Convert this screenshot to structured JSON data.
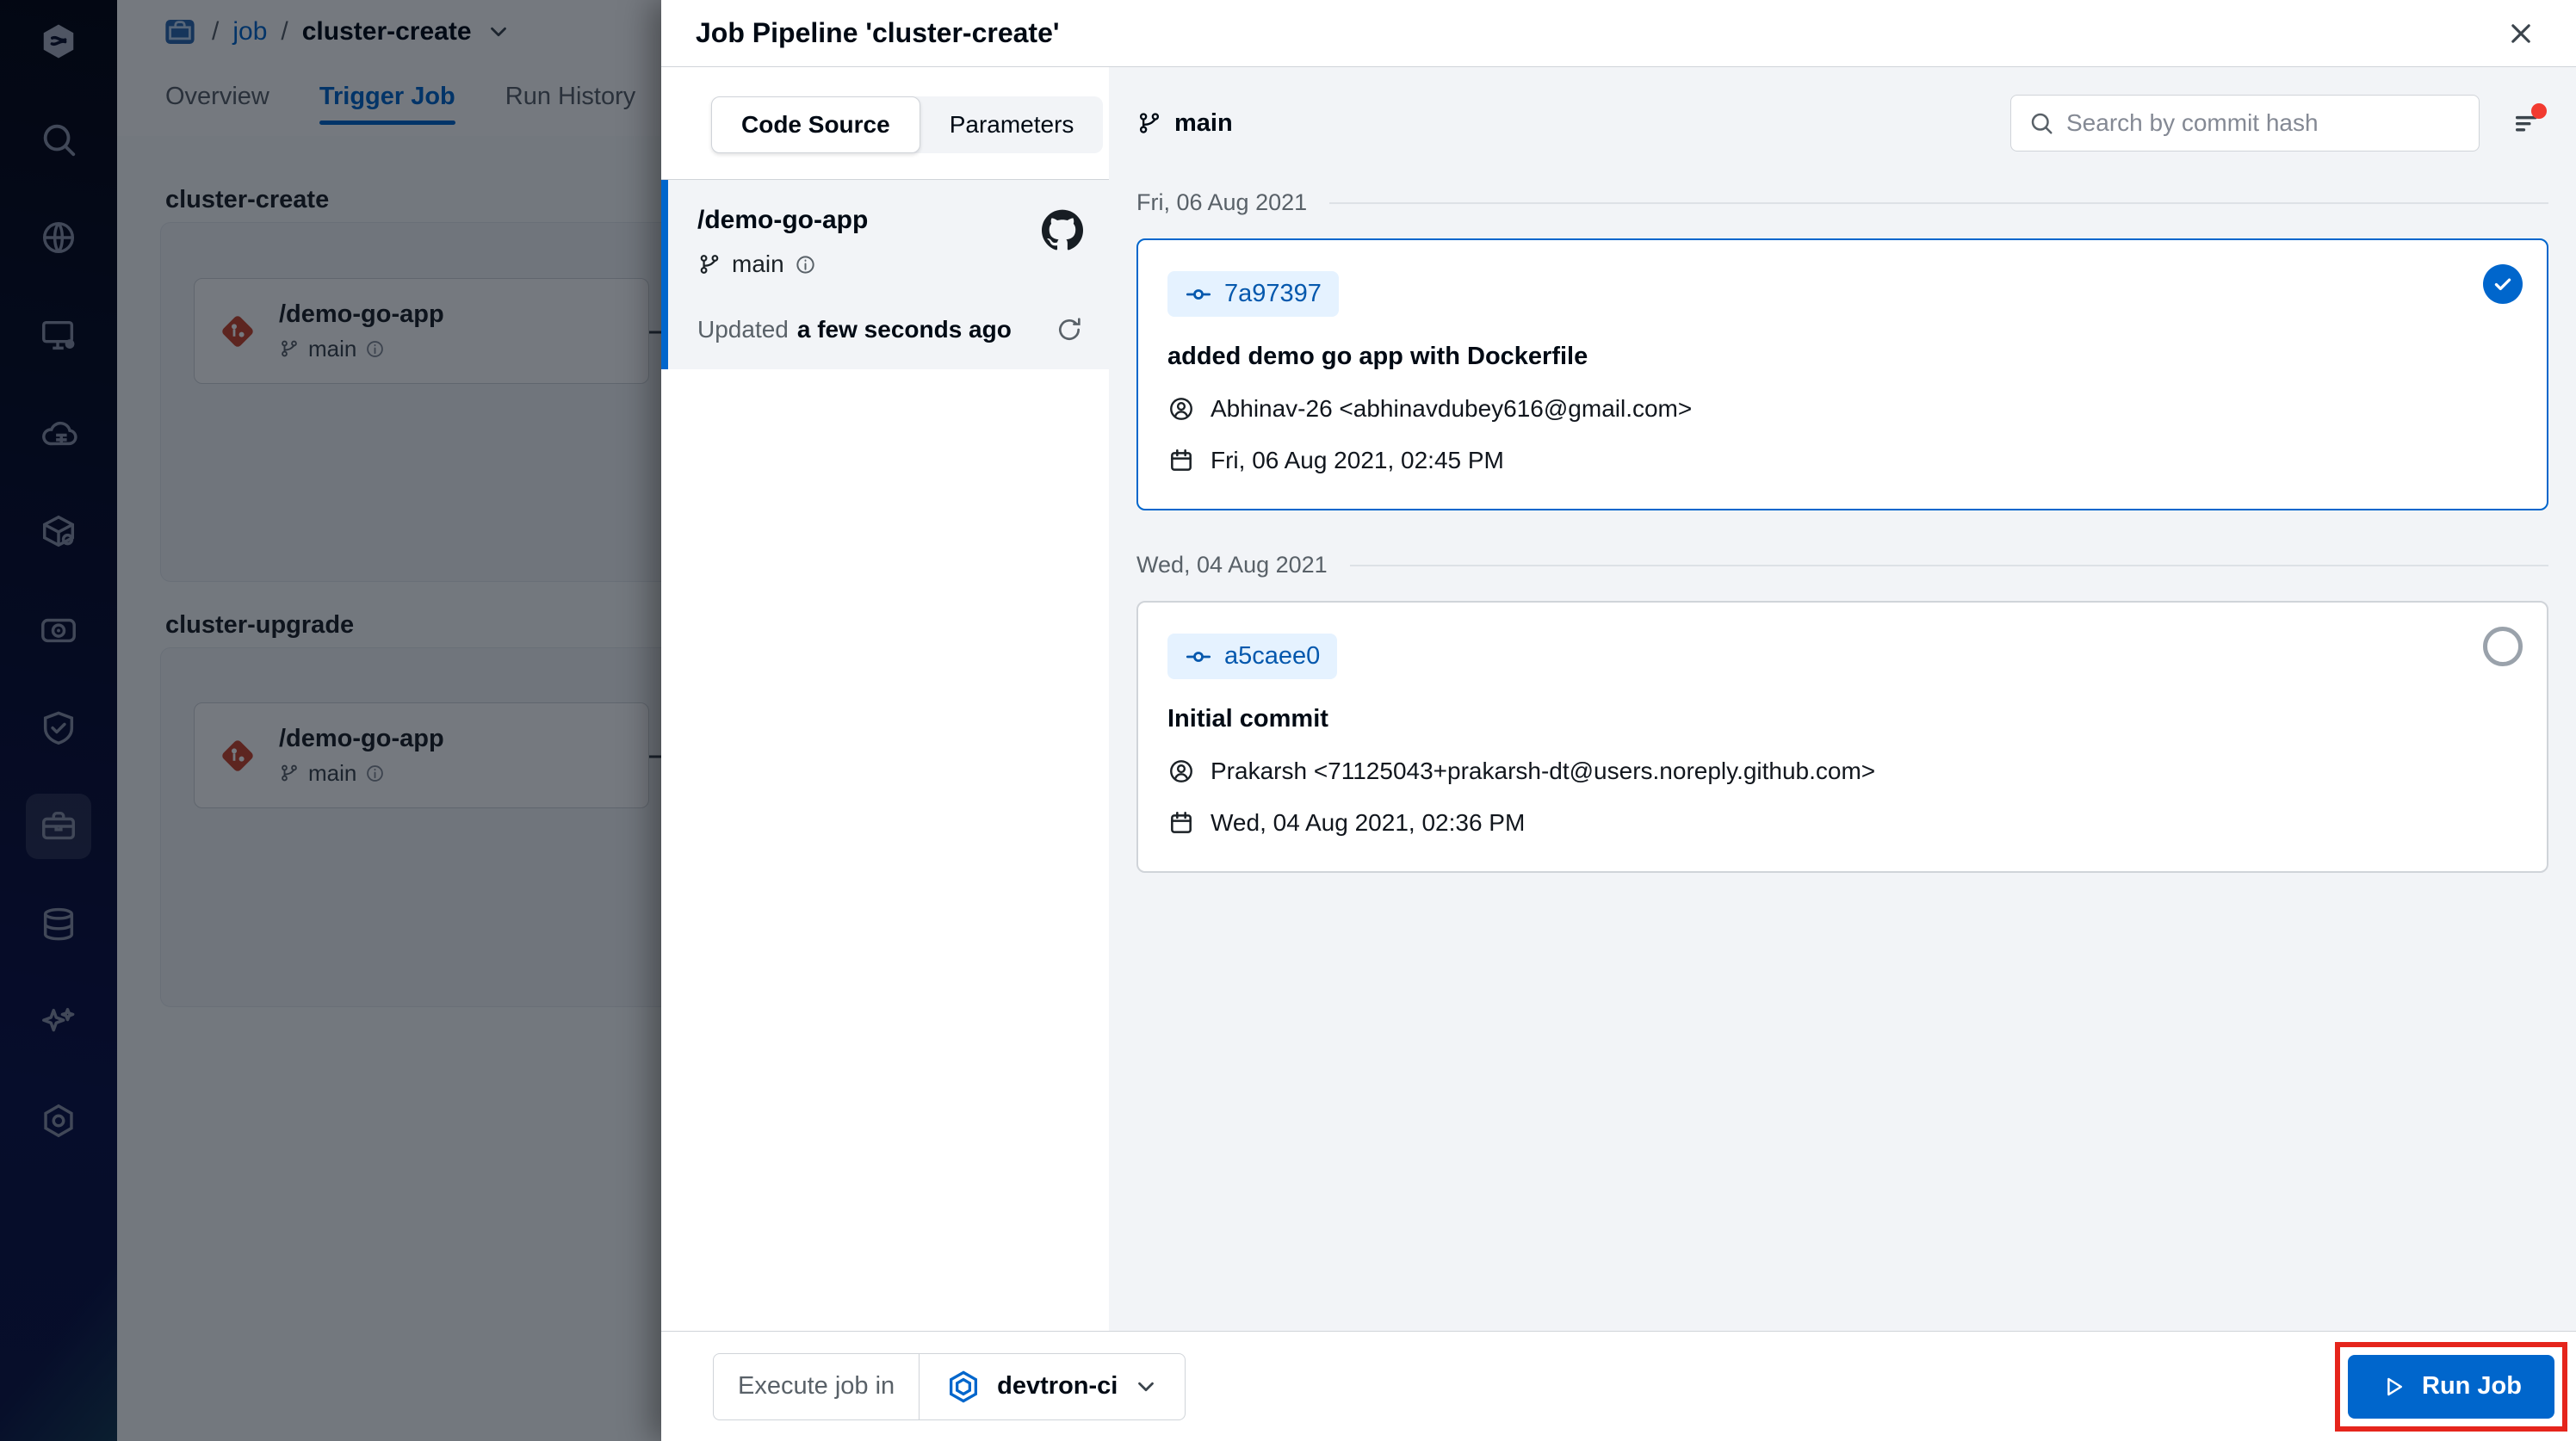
{
  "sidebar": {
    "icons": [
      "devtron-logo",
      "search",
      "global-config-globe",
      "app-group-monitor",
      "build-cloud",
      "deploy-package",
      "observe-camera",
      "security-shield",
      "jobs-briefcase",
      "resource-browser-stacks",
      "ai-sparkle",
      "settings-gear"
    ],
    "active": "jobs-briefcase"
  },
  "background": {
    "breadcrumb": {
      "separator": "/",
      "root": "job",
      "current": "cluster-create"
    },
    "tabs": [
      {
        "label": "Overview",
        "active": false
      },
      {
        "label": "Trigger Job",
        "active": true
      },
      {
        "label": "Run History",
        "active": false
      }
    ],
    "sections": [
      {
        "title": "cluster-create",
        "node": {
          "name": "/demo-go-app",
          "branch": "main"
        }
      },
      {
        "title": "cluster-upgrade",
        "node": {
          "name": "/demo-go-app",
          "branch": "main"
        }
      }
    ]
  },
  "modal": {
    "title": "Job Pipeline 'cluster-create'",
    "source_tabs": {
      "code_source": "Code Source",
      "parameters": "Parameters"
    },
    "material": {
      "name": "/demo-go-app",
      "branch": "main",
      "updated_label": "Updated",
      "updated_value": "a few seconds ago"
    },
    "branch_header": "main",
    "search": {
      "placeholder": "Search by commit hash"
    },
    "commit_groups": [
      {
        "date": "Fri, 06 Aug 2021",
        "commit": {
          "hash": "7a97397",
          "message": "added demo go app with Dockerfile",
          "author": "Abhinav-26 <abhinavdubey616@gmail.com>",
          "time": "Fri, 06 Aug 2021, 02:45 PM",
          "selected": true
        }
      },
      {
        "date": "Wed, 04 Aug 2021",
        "commit": {
          "hash": "a5caee0",
          "message": "Initial commit",
          "author": "Prakarsh <71125043+prakarsh-dt@users.noreply.github.com>",
          "time": "Wed, 04 Aug 2021, 02:36 PM",
          "selected": false
        }
      }
    ],
    "footer": {
      "execute_label": "Execute job in",
      "environment": "devtron-ci",
      "run_label": "Run Job"
    }
  },
  "colors": {
    "accent": "#0066cc",
    "selected_border": "#0066cc",
    "chip_bg": "#e5f2ff",
    "chip_text": "#0558ad",
    "annotation_red": "#e5251c",
    "panel_bg": "#f2f4f7",
    "border": "#d0d4d9"
  }
}
